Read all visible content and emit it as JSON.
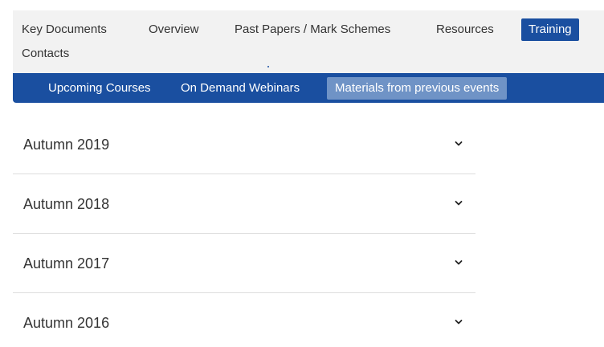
{
  "top_nav": {
    "items": [
      {
        "label": "Key Documents"
      },
      {
        "label": "Overview"
      },
      {
        "label": "Past Papers / Mark Schemes"
      },
      {
        "label": "Resources"
      },
      {
        "label": "Training"
      },
      {
        "label": "Contacts"
      }
    ],
    "active": "Training"
  },
  "sub_nav": {
    "items": [
      {
        "label": "Upcoming Courses"
      },
      {
        "label": "On Demand Webinars"
      },
      {
        "label": "Materials from previous events"
      }
    ],
    "active": "Materials from previous events"
  },
  "accordion": {
    "items": [
      {
        "title": "Autumn 2019",
        "icon": "chevron-down-icon"
      },
      {
        "title": "Autumn 2018",
        "icon": "chevron-down-icon"
      },
      {
        "title": "Autumn 2017",
        "icon": "chevron-down-icon"
      },
      {
        "title": "Autumn 2016",
        "icon": "chevron-down-icon"
      }
    ]
  },
  "colors": {
    "brand_blue": "#1a4fa0",
    "sub_nav_active": "#6f93c6",
    "top_nav_bg": "#f2f2f2",
    "divider": "#dddddd"
  }
}
